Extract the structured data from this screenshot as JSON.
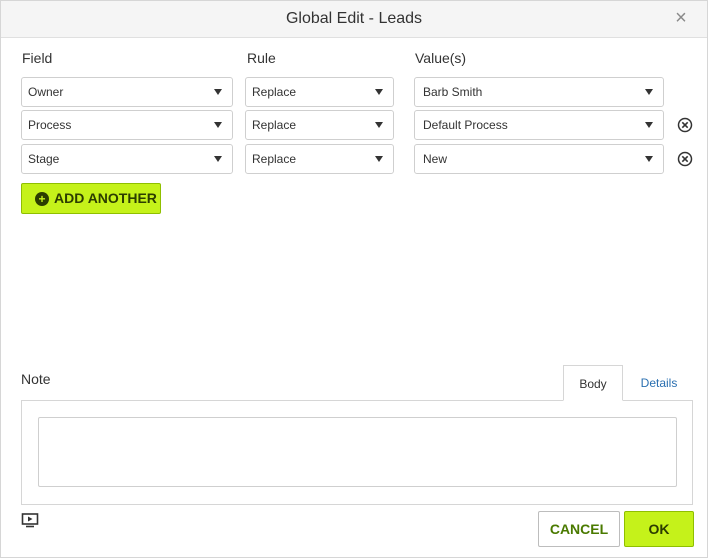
{
  "dialog": {
    "title": "Global Edit - Leads",
    "close_icon": "close-icon"
  },
  "columns": {
    "field": "Field",
    "rule": "Rule",
    "values": "Value(s)"
  },
  "rows": [
    {
      "field": "Owner",
      "rule": "Replace",
      "value": "Barb Smith",
      "removable": false
    },
    {
      "field": "Process",
      "rule": "Replace",
      "value": "Default Process",
      "removable": true
    },
    {
      "field": "Stage",
      "rule": "Replace",
      "value": "New",
      "removable": true
    }
  ],
  "add_another": {
    "label": "ADD ANOTHER",
    "icon": "plus-circle-icon"
  },
  "note": {
    "label": "Note",
    "tabs": [
      {
        "label": "Body",
        "active": true
      },
      {
        "label": "Details",
        "active": false
      }
    ],
    "body_value": ""
  },
  "footer": {
    "screen_icon": "play-screen-icon",
    "cancel_label": "CANCEL",
    "ok_label": "OK"
  },
  "colors": {
    "accent": "#c5f21a",
    "accent_text": "#2c3d00",
    "link": "#2a6fb0"
  }
}
